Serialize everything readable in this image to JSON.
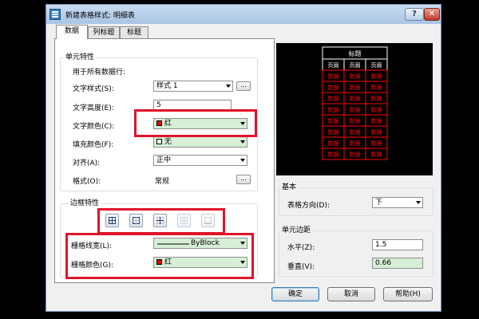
{
  "window": {
    "title": "新建表格样式: 明细表",
    "help_button": "?",
    "close_button": "✕"
  },
  "tabs": [
    {
      "label": "数据"
    },
    {
      "label": "列标题"
    },
    {
      "label": "标题"
    }
  ],
  "cell_properties": {
    "group_label": "单元特性",
    "apply_all_label": "用于所有数据行:",
    "text_style_label": "文字样式(S):",
    "text_style_value": "样式 1",
    "text_style_browse": "...",
    "text_height_label": "文字高度(E):",
    "text_height_value": "5",
    "text_color_label": "文字颜色(C):",
    "text_color_value": "红",
    "fill_color_label": "填充颜色(F):",
    "fill_color_value": "无",
    "align_label": "对齐(A):",
    "align_value": "正中",
    "format_label": "格式(O):",
    "format_value": "常规",
    "format_browse": "..."
  },
  "border_properties": {
    "group_label": "边框特性",
    "buttons": [
      "all-borders",
      "outside-borders",
      "inside-borders",
      "no-borders",
      "bottom-border"
    ],
    "lineweight_label": "栅格线宽(L):",
    "lineweight_value": "ByBlock",
    "grid_color_label": "栅格颜色(G):",
    "grid_color_value": "红"
  },
  "preview": {
    "title": "标题",
    "headers": [
      "页眉",
      "页眉",
      "页眉"
    ],
    "cell_text": "数据",
    "rows": 8
  },
  "general": {
    "group_label": "基本",
    "direction_label": "表格方向(D):",
    "direction_value": "下"
  },
  "margins": {
    "group_label": "单元边距",
    "horizontal_label": "水平(Z):",
    "horizontal_value": "1.5",
    "vertical_label": "垂直(V):",
    "vertical_value": "0.66"
  },
  "footer": {
    "ok": "确定",
    "cancel": "取消",
    "help": "帮助(H)"
  },
  "colors": {
    "highlight": "#e0142a",
    "preview_red": "#ff0000"
  }
}
